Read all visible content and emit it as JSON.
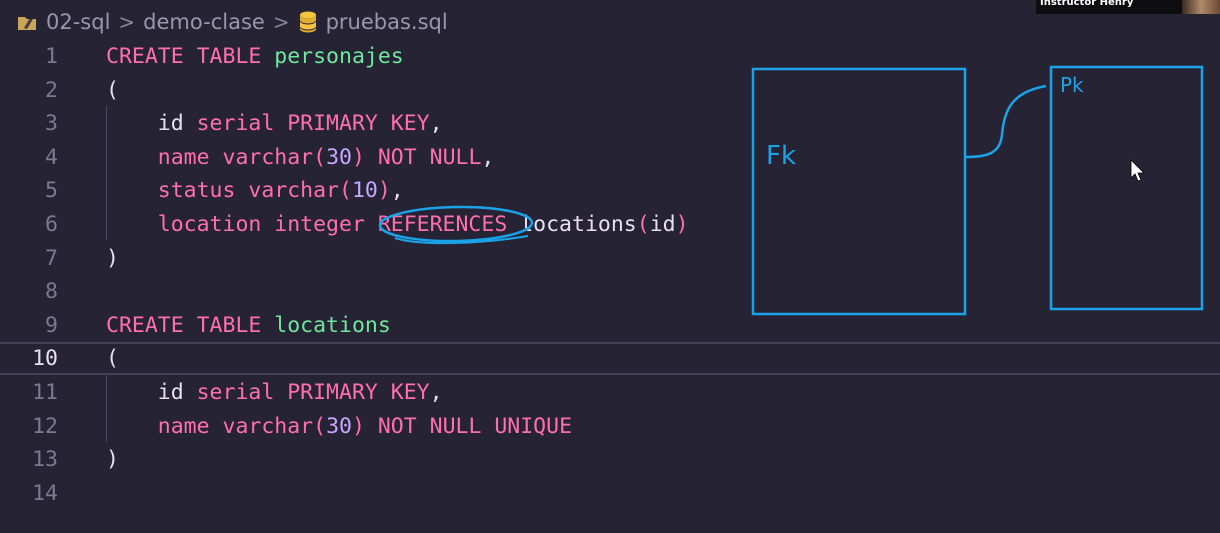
{
  "breadcrumb": {
    "items": [
      "02-sql",
      "demo-clase",
      "pruebas.sql"
    ],
    "separator": ">"
  },
  "editor": {
    "current_line": 10,
    "lines": [
      {
        "n": "1",
        "tokens": [
          [
            "kw",
            "CREATE TABLE "
          ],
          [
            "nm",
            "personajes"
          ]
        ]
      },
      {
        "n": "2",
        "tokens": [
          [
            "tx",
            "("
          ]
        ]
      },
      {
        "n": "3",
        "tokens": [
          [
            "tx",
            "    id "
          ],
          [
            "kw",
            "serial PRIMARY KEY"
          ],
          [
            "tx",
            ","
          ]
        ]
      },
      {
        "n": "4",
        "tokens": [
          [
            "kw",
            "    name varchar"
          ],
          [
            "pn",
            "("
          ],
          [
            "num",
            "30"
          ],
          [
            "pn",
            ")"
          ],
          [
            "kw",
            " NOT NULL"
          ],
          [
            "tx",
            ","
          ]
        ]
      },
      {
        "n": "5",
        "tokens": [
          [
            "kw",
            "    status varchar"
          ],
          [
            "pn",
            "("
          ],
          [
            "num",
            "10"
          ],
          [
            "pn",
            ")"
          ],
          [
            "tx",
            ","
          ]
        ]
      },
      {
        "n": "6",
        "tokens": [
          [
            "kw",
            "    location integer "
          ],
          [
            "kw",
            "REFERENCES"
          ],
          [
            "tx",
            " locations"
          ],
          [
            "pn",
            "("
          ],
          [
            "tx",
            "id"
          ],
          [
            "pn",
            ")"
          ]
        ]
      },
      {
        "n": "7",
        "tokens": [
          [
            "tx",
            ")"
          ]
        ]
      },
      {
        "n": "8",
        "tokens": []
      },
      {
        "n": "9",
        "tokens": [
          [
            "kw",
            "CREATE TABLE "
          ],
          [
            "nm",
            "locations"
          ]
        ]
      },
      {
        "n": "10",
        "tokens": [
          [
            "tx",
            "("
          ]
        ]
      },
      {
        "n": "11",
        "tokens": [
          [
            "tx",
            "    id "
          ],
          [
            "kw",
            "serial PRIMARY KEY"
          ],
          [
            "tx",
            ","
          ]
        ]
      },
      {
        "n": "12",
        "tokens": [
          [
            "kw",
            "    name varchar"
          ],
          [
            "pn",
            "("
          ],
          [
            "num",
            "30"
          ],
          [
            "pn",
            ")"
          ],
          [
            "kw",
            " NOT NULL UNIQUE"
          ]
        ]
      },
      {
        "n": "13",
        "tokens": [
          [
            "tx",
            ")"
          ]
        ]
      },
      {
        "n": "14",
        "tokens": []
      }
    ]
  },
  "annotations": {
    "fk_label": "Fk",
    "pk_label": "Pk",
    "ink_color": "#1aa3e8"
  },
  "webcam": {
    "label": "Instructor Henry"
  },
  "colors": {
    "background": "#262335",
    "keyword": "#ff6fae",
    "table_name": "#6ee89b",
    "number": "#c4a9ff",
    "text": "#e6e1f0",
    "line_number": "#7d7994"
  }
}
